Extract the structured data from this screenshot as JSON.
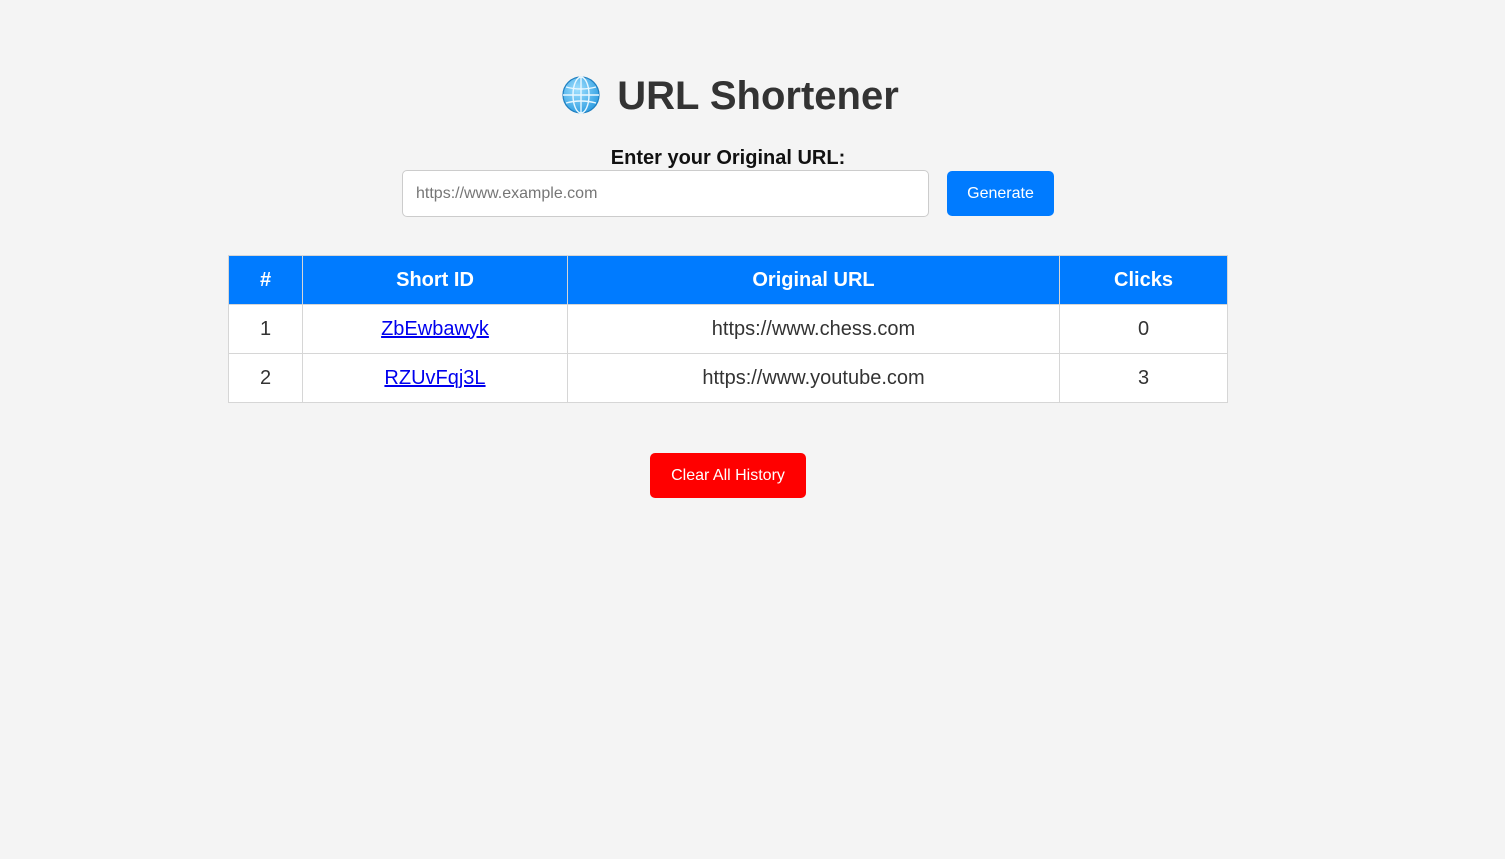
{
  "header": {
    "title": "URL Shortener",
    "icon": "globe-icon"
  },
  "form": {
    "label": "Enter your Original URL:",
    "input_value": "",
    "input_placeholder": "https://www.example.com",
    "generate_label": "Generate"
  },
  "table": {
    "columns": [
      "#",
      "Short ID",
      "Original URL",
      "Clicks"
    ],
    "rows": [
      {
        "index": "1",
        "short_id": "ZbEwbawyk",
        "original_url": "https://www.chess.com",
        "clicks": "0"
      },
      {
        "index": "2",
        "short_id": "RZUvFqj3L",
        "original_url": "https://www.youtube.com",
        "clicks": "3"
      }
    ]
  },
  "actions": {
    "clear_label": "Clear All History"
  },
  "colors": {
    "accent": "#007bff",
    "danger": "#ff0000",
    "background": "#f4f4f4",
    "link": "#0000ee"
  }
}
